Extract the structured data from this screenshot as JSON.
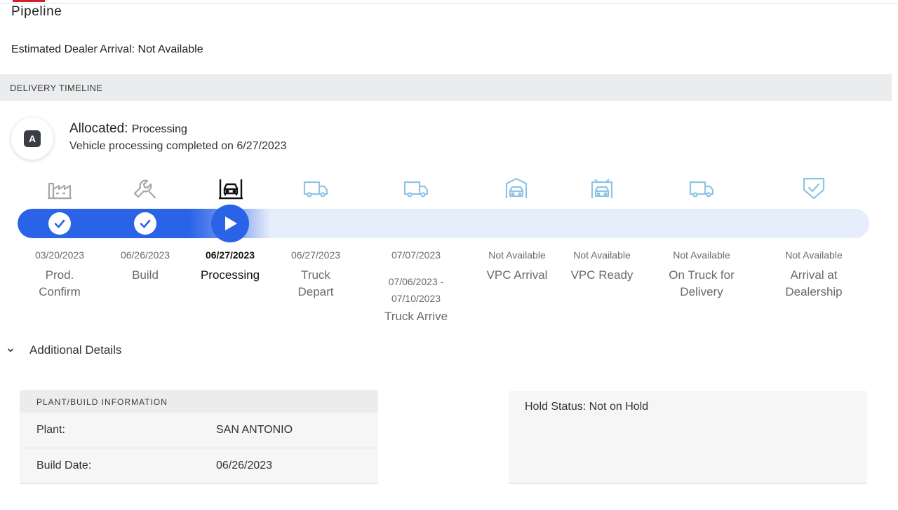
{
  "page": {
    "title": "Pipeline",
    "eta_label": "Estimated Dealer Arrival: Not Available"
  },
  "timeline": {
    "header": "DELIVERY TIMELINE",
    "badge_letter": "A",
    "status_label": "Allocated:",
    "status_value": "Processing",
    "status_detail": "Vehicle processing completed on 6/27/2023",
    "progress_fraction": 0.3,
    "steps": [
      {
        "label_1": "Prod.",
        "label_2": "Confirm",
        "date": "03/20/2023",
        "state": "complete",
        "icon": "factory-icon"
      },
      {
        "label_1": "Build",
        "label_2": "",
        "date": "06/26/2023",
        "state": "complete",
        "icon": "wrench-icon"
      },
      {
        "label_1": "Processing",
        "label_2": "",
        "date": "06/27/2023",
        "state": "current",
        "icon": "vehicle-lift-icon"
      },
      {
        "label_1": "Truck",
        "label_2": "Depart",
        "date": "06/27/2023",
        "state": "upcoming",
        "icon": "truck-icon"
      },
      {
        "label_1": "Truck Arrive",
        "label_2": "",
        "date": "07/07/2023",
        "range_1": "07/06/2023 -",
        "range_2": "07/10/2023",
        "state": "upcoming",
        "icon": "truck-icon"
      },
      {
        "label_1": "VPC Arrival",
        "label_2": "",
        "date": "Not Available",
        "state": "upcoming",
        "icon": "car-garage-icon"
      },
      {
        "label_1": "VPC Ready",
        "label_2": "",
        "date": "Not Available",
        "state": "upcoming",
        "icon": "car-ready-icon"
      },
      {
        "label_1": "On Truck for",
        "label_2": "Delivery",
        "date": "Not Available",
        "state": "upcoming",
        "icon": "truck-icon"
      },
      {
        "label_1": "Arrival at",
        "label_2": "Dealership",
        "date": "Not Available",
        "state": "upcoming",
        "icon": "shield-check-icon"
      }
    ]
  },
  "details": {
    "toggle_label": "Additional Details",
    "plant_card": {
      "header": "PLANT/BUILD INFORMATION",
      "rows": [
        {
          "key": "Plant:",
          "value": "SAN ANTONIO"
        },
        {
          "key": "Build Date:",
          "value": "06/26/2023"
        }
      ]
    },
    "hold_status": "Hold Status: Not on Hold"
  },
  "colors": {
    "accent": "#2a63e8",
    "track": "#e6edfb",
    "upcoming_icon": "#8ec5e6",
    "complete_icon": "#a6a6a6",
    "brand": "#d4202c"
  }
}
